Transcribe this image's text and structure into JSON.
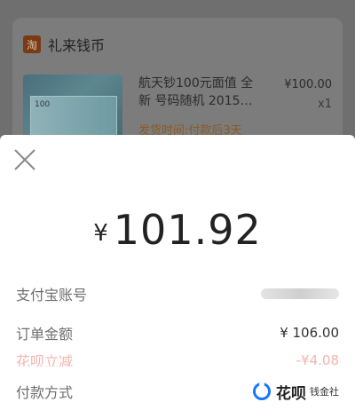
{
  "order_card": {
    "shop_logo_char": "淘",
    "shop_name": "礼来钱币",
    "item_title": "航天钞100元面值 全新 号码随机 2015…",
    "item_price": "¥100.00",
    "item_qty": "x1",
    "ship_time": "发货时间:付款后3天",
    "thumb_note_text": "100"
  },
  "payment_sheet": {
    "currency_symbol": "¥",
    "amount": "101.92",
    "rows": {
      "alipay_account_label": "支付宝账号",
      "order_amount_label": "订单金额",
      "order_amount_value": "¥ 106.00",
      "huabei_discount_label": "花呗立减",
      "huabei_discount_value": "-¥4.08",
      "payment_method_label": "付款方式",
      "payment_method_value": "花呗",
      "watermark_text": "钱金社"
    }
  },
  "colors": {
    "accent": "#1677ff",
    "discount": "#f0b5b0",
    "overlay": "#6f6f6f"
  }
}
